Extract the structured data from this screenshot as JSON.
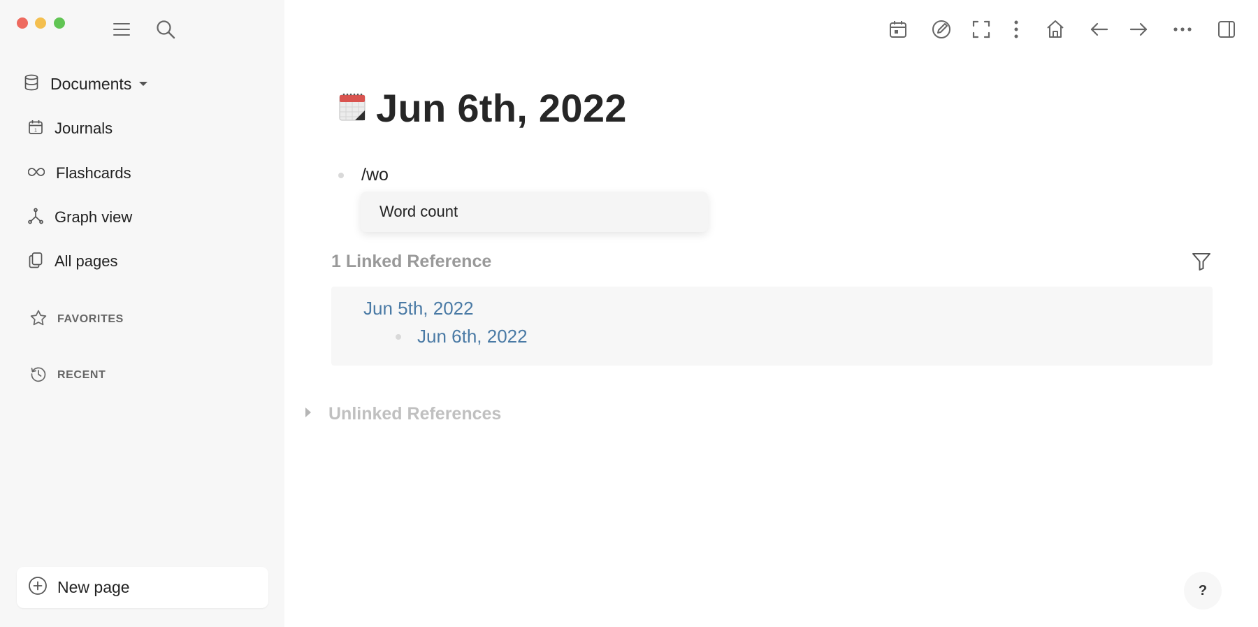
{
  "sidebar": {
    "repo": {
      "label": "Documents",
      "icon": "database-icon"
    },
    "items": [
      {
        "label": "Journals",
        "icon": "calendar-icon"
      },
      {
        "label": "Flashcards",
        "icon": "infinity-icon"
      },
      {
        "label": "Graph view",
        "icon": "graph-icon"
      },
      {
        "label": "All pages",
        "icon": "pages-icon"
      }
    ],
    "sections": [
      {
        "label": "FAVORITES",
        "icon": "star-icon"
      },
      {
        "label": "RECENT",
        "icon": "history-icon"
      }
    ],
    "new_page": {
      "label": "New page",
      "icon": "plus-circle-icon"
    }
  },
  "toolbar": {
    "icons": [
      "calendar-icon",
      "pencil-icon",
      "fullscreen-icon",
      "vertical-dots-icon",
      "home-icon",
      "arrow-left-icon",
      "arrow-right-icon",
      "more-icon",
      "sidebar-toggle-icon"
    ]
  },
  "page": {
    "title": "Jun 6th, 2022",
    "title_icon": "calendar-pad-icon",
    "block_text": "/wo",
    "autocomplete": {
      "items": [
        "Word count"
      ]
    },
    "linked_references": {
      "header": "1 Linked Reference",
      "page": "Jun 5th, 2022",
      "block_link": "Jun 6th, 2022"
    },
    "unlinked_references": {
      "header": "Unlinked References"
    }
  },
  "help": {
    "label": "?"
  },
  "colors": {
    "link": "#4a7aa5",
    "sidebar_bg": "#f7f7f7"
  }
}
